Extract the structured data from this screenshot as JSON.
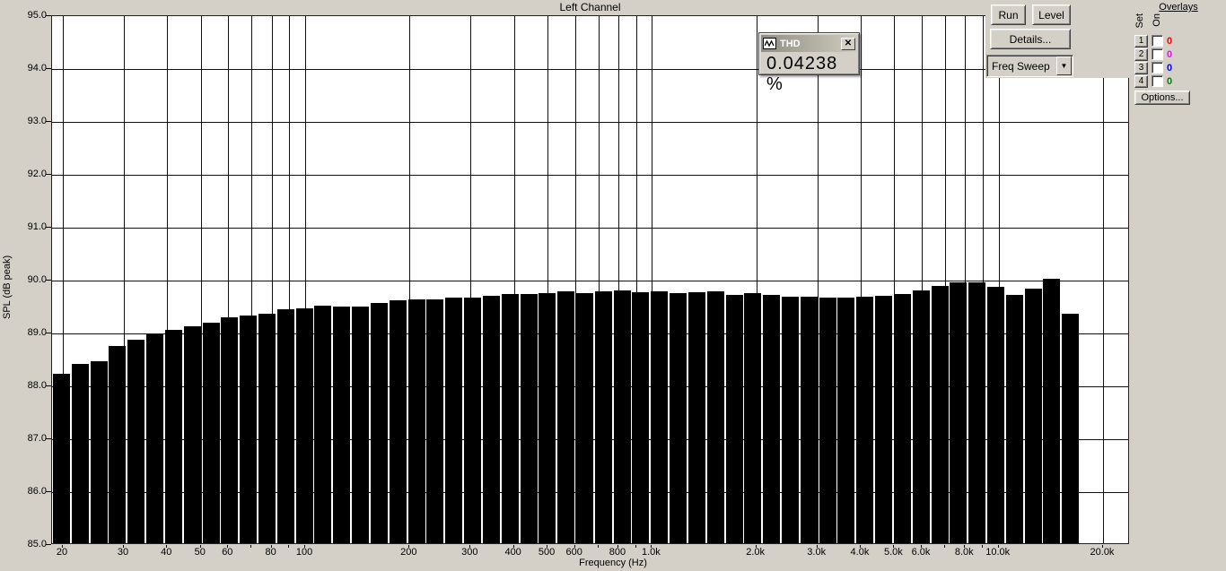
{
  "chart": {
    "title": "Left Channel",
    "ylabel": "SPL (dB peak)",
    "xlabel": "Frequency (Hz)"
  },
  "chart_data": {
    "type": "bar",
    "title": "Left Channel",
    "xlabel": "Frequency (Hz)",
    "ylabel": "SPL (dB peak)",
    "x_scale": "log",
    "x_range_hz": [
      20,
      20000
    ],
    "ylim": [
      85.0,
      95.0
    ],
    "y_tick_step": 1.0,
    "grid": true,
    "bar_color": "#000000",
    "y_ticks": [
      {
        "v": 95,
        "label": "95.0"
      },
      {
        "v": 94,
        "label": "94.0"
      },
      {
        "v": 93,
        "label": "93.0"
      },
      {
        "v": 92,
        "label": "92.0"
      },
      {
        "v": 91,
        "label": "91.0"
      },
      {
        "v": 90,
        "label": "90.0"
      },
      {
        "v": 89,
        "label": "89.0"
      },
      {
        "v": 88,
        "label": "88.0"
      },
      {
        "v": 87,
        "label": "87.0"
      },
      {
        "v": 86,
        "label": "86.0"
      },
      {
        "v": 85,
        "label": "85.0"
      }
    ],
    "x_ticks": [
      {
        "f": 20,
        "label": "20"
      },
      {
        "f": 30,
        "label": "30"
      },
      {
        "f": 40,
        "label": "40"
      },
      {
        "f": 50,
        "label": "50"
      },
      {
        "f": 60,
        "label": "60"
      },
      {
        "f": 80,
        "label": "80"
      },
      {
        "f": 100,
        "label": "100"
      },
      {
        "f": 200,
        "label": "200"
      },
      {
        "f": 300,
        "label": "300"
      },
      {
        "f": 400,
        "label": "400"
      },
      {
        "f": 500,
        "label": "500"
      },
      {
        "f": 600,
        "label": "600"
      },
      {
        "f": 800,
        "label": "800"
      },
      {
        "f": 1000,
        "label": "1.0k"
      },
      {
        "f": 2000,
        "label": "2.0k"
      },
      {
        "f": 3000,
        "label": "3.0k"
      },
      {
        "f": 4000,
        "label": "4.0k"
      },
      {
        "f": 5000,
        "label": "5.0k"
      },
      {
        "f": 6000,
        "label": "6.0k"
      },
      {
        "f": 8000,
        "label": "8.0k"
      },
      {
        "f": 10000,
        "label": "10.0k"
      },
      {
        "f": 20000,
        "label": "20.0k"
      }
    ],
    "gridline_frequencies": [
      20,
      30,
      40,
      50,
      60,
      70,
      80,
      90,
      100,
      200,
      300,
      400,
      500,
      600,
      700,
      800,
      900,
      1000,
      2000,
      3000,
      4000,
      5000,
      6000,
      7000,
      8000,
      9000,
      10000,
      20000
    ],
    "frequencies_hz": [
      20,
      22.7,
      25.7,
      29.1,
      33,
      37.4,
      42.3,
      48,
      54.3,
      61.5,
      69.7,
      78.9,
      89.4,
      101,
      115,
      130,
      147,
      167,
      189,
      214,
      242,
      274,
      311,
      352,
      398,
      451,
      511,
      579,
      656,
      743,
      841,
      953,
      1079,
      1222,
      1384,
      1568,
      1776,
      2011,
      2278,
      2580,
      2922,
      3310,
      3749,
      4246,
      4809,
      5447,
      6169,
      6987,
      7914,
      8963,
      10151,
      11497,
      13022,
      14749,
      16705
    ],
    "values_db": [
      88.23,
      88.42,
      88.47,
      88.77,
      88.88,
      88.98,
      89.07,
      89.14,
      89.21,
      89.3,
      89.34,
      89.38,
      89.45,
      89.48,
      89.52,
      89.51,
      89.51,
      89.58,
      89.62,
      89.65,
      89.64,
      89.68,
      89.68,
      89.72,
      89.74,
      89.74,
      89.77,
      89.79,
      89.77,
      89.8,
      89.81,
      89.78,
      89.79,
      89.77,
      89.78,
      89.79,
      89.73,
      89.76,
      89.73,
      89.7,
      89.7,
      89.67,
      89.67,
      89.69,
      89.71,
      89.75,
      89.82,
      89.9,
      89.96,
      89.96,
      89.88,
      89.73,
      89.85,
      90.03,
      89.37
    ]
  },
  "thd_window": {
    "title": "THD",
    "value": "0.04238 %",
    "close_label": "x"
  },
  "controls": {
    "run_label": "Run",
    "level_label": "Level",
    "details_label": "Details...",
    "mode_value": "Freq Sweep",
    "dropdown_arrow": "▼"
  },
  "overlays": {
    "header": "Overlays",
    "col_set": "Set",
    "col_on": "On",
    "rows": [
      {
        "set": "1",
        "count": "0",
        "color": "#ff0000"
      },
      {
        "set": "2",
        "count": "0",
        "color": "#ff00ff"
      },
      {
        "set": "3",
        "count": "0",
        "color": "#0000ff"
      },
      {
        "set": "4",
        "count": "0",
        "color": "#008000"
      }
    ],
    "options_label": "Options..."
  }
}
